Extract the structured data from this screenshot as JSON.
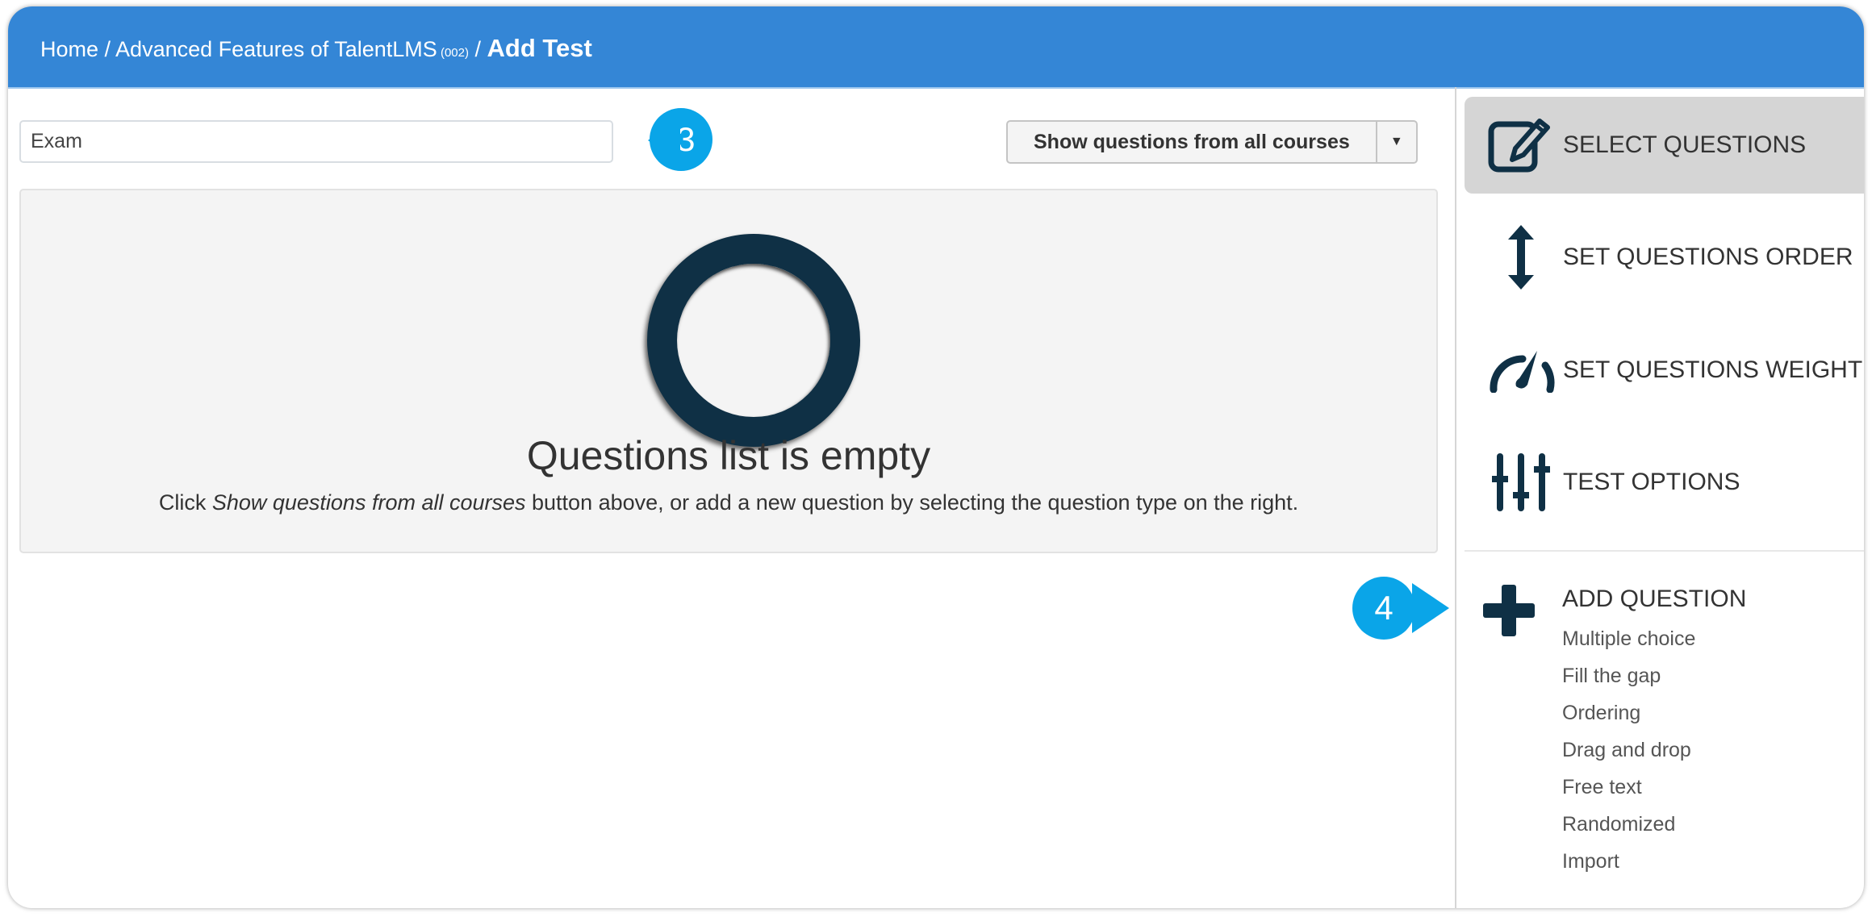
{
  "header": {
    "breadcrumb_home": "Home",
    "breadcrumb_sep1": " / ",
    "breadcrumb_course": "Advanced Features of TalentLMS",
    "breadcrumb_course_code": " (002)",
    "breadcrumb_sep2": " / ",
    "breadcrumb_current": "Add Test"
  },
  "toolbar": {
    "test_name_value": "Exam",
    "show_questions_label": "Show questions from all courses",
    "dropdown_icon": "caret-down-icon"
  },
  "callouts": {
    "step3": "3",
    "step4": "4",
    "color": "#0aa5e8"
  },
  "empty_state": {
    "icon": "empty-ring-icon",
    "title": "Questions list is empty",
    "text_prefix": "Click ",
    "text_emphasis": "Show questions from all courses",
    "text_suffix": " button above, or add a new question by selecting the question type on the right."
  },
  "sidebar": {
    "items": [
      {
        "label": "SELECT QUESTIONS",
        "icon": "edit-icon",
        "active": true
      },
      {
        "label": "SET QUESTIONS ORDER",
        "icon": "vertical-arrows-icon",
        "active": false
      },
      {
        "label": "SET QUESTIONS WEIGHT",
        "icon": "gauge-icon",
        "active": false
      },
      {
        "label": "TEST OPTIONS",
        "icon": "sliders-icon",
        "active": false
      }
    ],
    "add_question": {
      "title": "ADD QUESTION",
      "icon": "plus-icon",
      "types": [
        "Multiple choice",
        "Fill the gap",
        "Ordering",
        "Drag and drop",
        "Free text",
        "Randomized",
        "Import"
      ]
    }
  },
  "colors": {
    "header": "#3486d6",
    "icon": "#0f3045",
    "active_bg": "#d5d5d5"
  }
}
